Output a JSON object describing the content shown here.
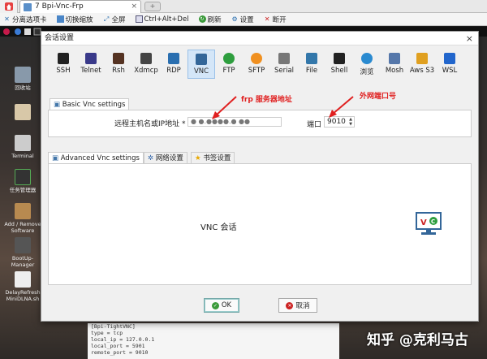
{
  "tabbar": {
    "active_tab": "7  Bpi-Vnc-Frp",
    "close": "×",
    "new_tab": "+"
  },
  "toolbar": {
    "items": [
      {
        "icon": "detach-tab-icon",
        "label": "分离选项卡"
      },
      {
        "icon": "zoom-toggle-icon",
        "label": "切换缩放"
      },
      {
        "icon": "fullscreen-icon",
        "label": "全屏"
      },
      {
        "icon": "keyboard-icon",
        "label": "Ctrl+Alt+Del"
      },
      {
        "icon": "refresh-icon",
        "label": "刷新"
      },
      {
        "icon": "settings-icon",
        "label": "设置"
      },
      {
        "icon": "disconnect-icon",
        "label": "断开"
      }
    ]
  },
  "desktop": {
    "icons": [
      {
        "label": "回收站"
      },
      {
        "label": ""
      },
      {
        "label": "Terminal"
      },
      {
        "label": "任务管理器"
      },
      {
        "label": "Add / Remove Software"
      },
      {
        "label": "BootUp-Manager"
      },
      {
        "label": "DelayRefreshMiniDLNA.sh"
      }
    ],
    "terminal_lines": [
      "[Bpi-TightVNC]",
      "type = tcp",
      "local_ip = 127.0.0.1",
      "local_port = 5901",
      "remote_port = 9010"
    ],
    "watermark": "知乎 @克利马古"
  },
  "dialog": {
    "title": "会话设置",
    "close": "×",
    "protocols": [
      {
        "label": "SSH",
        "color": "#222222"
      },
      {
        "label": "Telnet",
        "color": "#3a3a8a"
      },
      {
        "label": "Rsh",
        "color": "#553322"
      },
      {
        "label": "Xdmcp",
        "color": "#444444"
      },
      {
        "label": "RDP",
        "color": "#2a6fb0"
      },
      {
        "label": "VNC",
        "color": "#336699"
      },
      {
        "label": "FTP",
        "color": "#2e9e3e"
      },
      {
        "label": "SFTP",
        "color": "#f09020"
      },
      {
        "label": "Serial",
        "color": "#777777"
      },
      {
        "label": "File",
        "color": "#3377aa"
      },
      {
        "label": "Shell",
        "color": "#222222"
      },
      {
        "label": "浏览",
        "color": "#2a8ad0"
      },
      {
        "label": "Mosh",
        "color": "#5577aa"
      },
      {
        "label": "Aws S3",
        "color": "#e0a020"
      },
      {
        "label": "WSL",
        "color": "#2266cc"
      }
    ],
    "basic_tab": "Basic Vnc settings",
    "host_label": "远程主机名或IP地址 *",
    "host_value": "● ●.●●●●.● ●●",
    "port_label": "端口",
    "port_value": "9010",
    "annot_frp": "frp 服务器地址",
    "annot_port": "外网端口号",
    "adv_tabs": [
      "Advanced Vnc settings",
      "网络设置",
      "书签设置"
    ],
    "session_label": "VNC 会话",
    "ok": "OK",
    "cancel": "取消"
  }
}
